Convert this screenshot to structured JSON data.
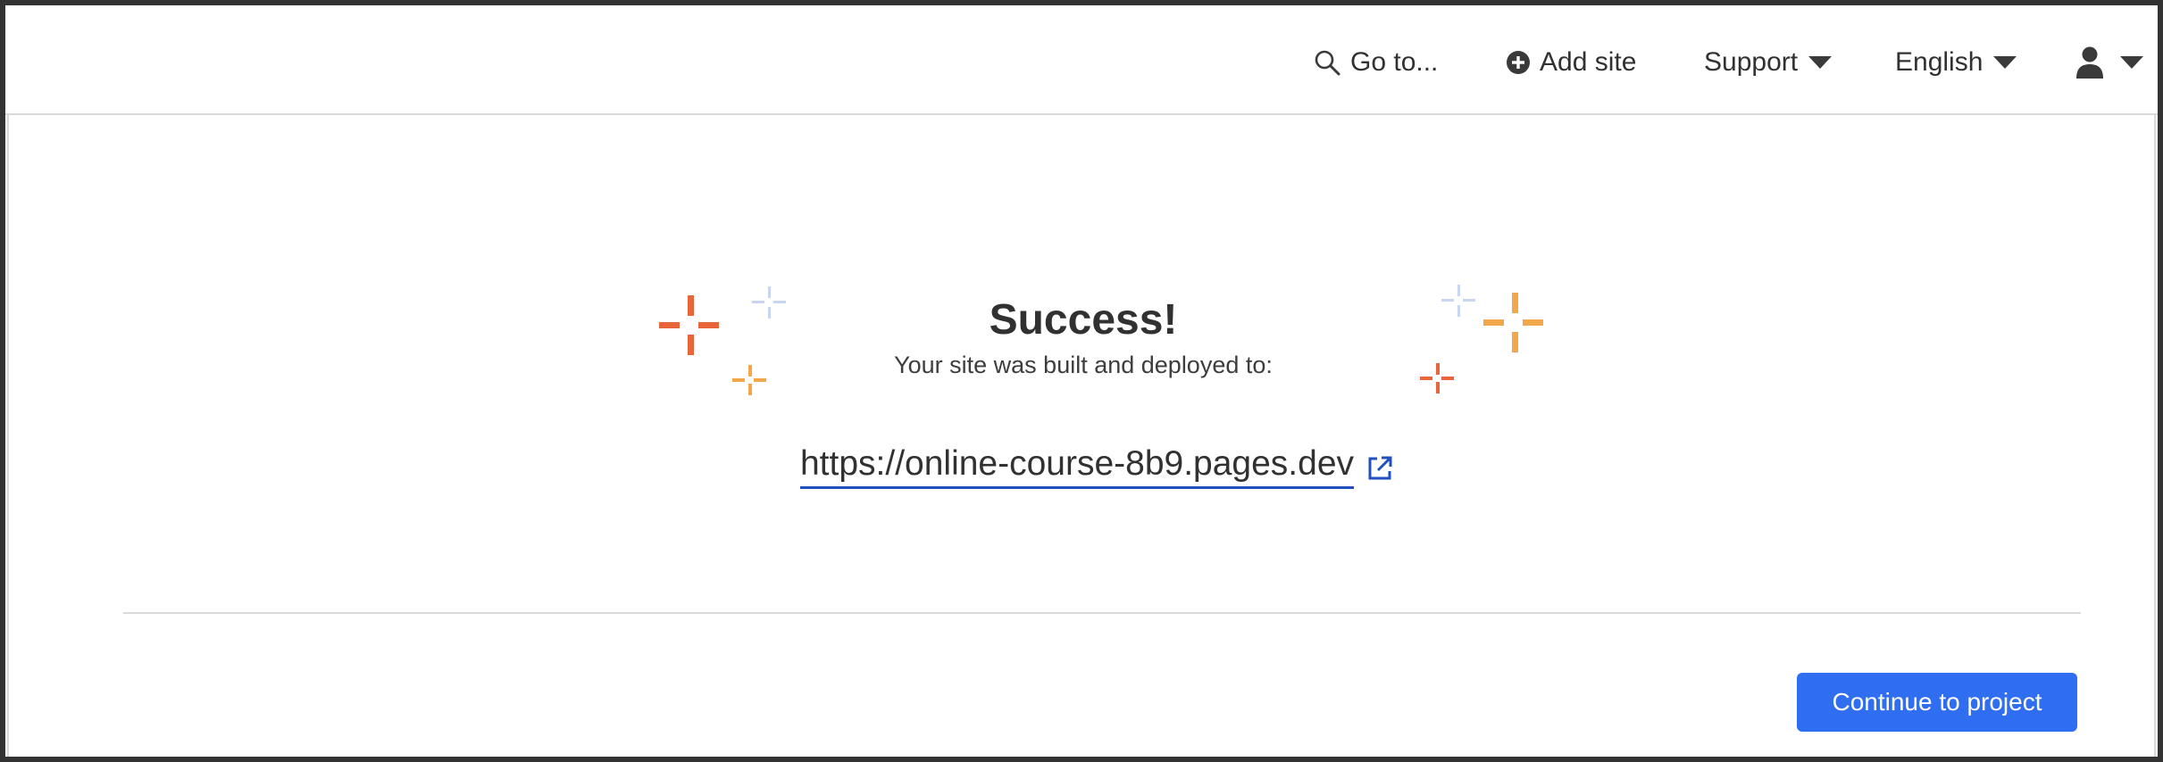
{
  "header": {
    "goto": {
      "label": "Go to...",
      "icon": "search-icon"
    },
    "add_site": {
      "label": "Add site",
      "icon": "plus-circle-icon"
    },
    "support": {
      "label": "Support",
      "icon": "chevron-down-icon"
    },
    "language": {
      "label": "English",
      "icon": "chevron-down-icon"
    },
    "user": {
      "icon": "user-icon"
    }
  },
  "main": {
    "title": "Success!",
    "subtitle": "Your site was built and deployed to:",
    "deploy_url": "https://online-course-8b9.pages.dev",
    "continue_label": "Continue to project"
  },
  "colors": {
    "accent": "#2f6ef0",
    "link_underline": "#2050c0",
    "sparkle_orange_red": "#e8653a",
    "sparkle_orange": "#f2a84a",
    "sparkle_light_blue": "#c8d6f2",
    "text": "#313131"
  }
}
